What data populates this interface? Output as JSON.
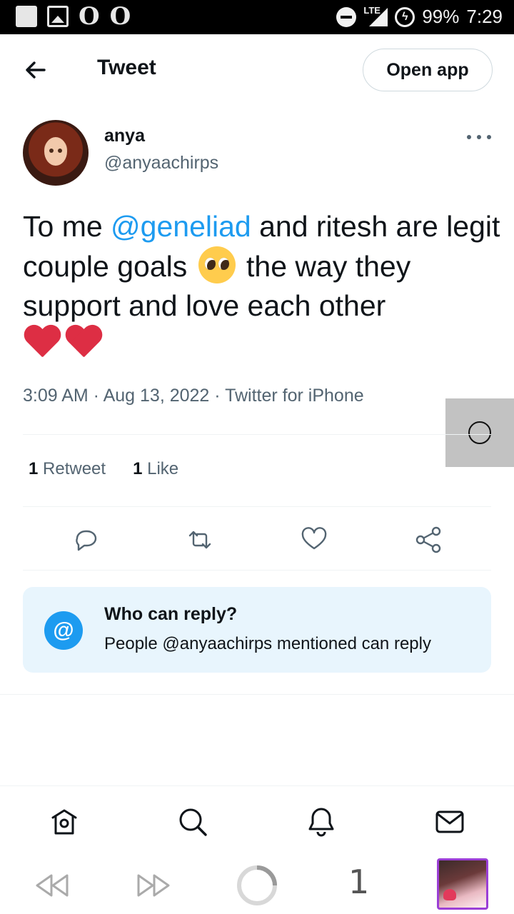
{
  "status_bar": {
    "battery": "99%",
    "time": "7:29",
    "network": "LTE"
  },
  "header": {
    "title": "Tweet",
    "open_app_label": "Open app"
  },
  "author": {
    "name": "anya",
    "handle": "@anyaachirps"
  },
  "tweet": {
    "part1": "To me ",
    "mention": "@geneliad",
    "part2": " and ritesh are legit couple goals ",
    "part3": " the way they support and love each other",
    "emojis": [
      "pleading-face",
      "red-heart",
      "red-heart"
    ]
  },
  "meta": {
    "time": "3:09 AM",
    "date": "Aug 13, 2022",
    "source": "Twitter for iPhone",
    "separator": " · "
  },
  "stats": {
    "retweets_count": "1",
    "retweets_label": "Retweet",
    "likes_count": "1",
    "likes_label": "Like"
  },
  "reply_settings": {
    "title": "Who can reply?",
    "subtitle": "People @anyaachirps mentioned can reply",
    "icon": "@"
  },
  "browser": {
    "tab_count": "1"
  },
  "colors": {
    "accent": "#1d9bf0",
    "text": "#0f1419",
    "secondary_text": "#536471",
    "heart": "#dd2e44"
  }
}
